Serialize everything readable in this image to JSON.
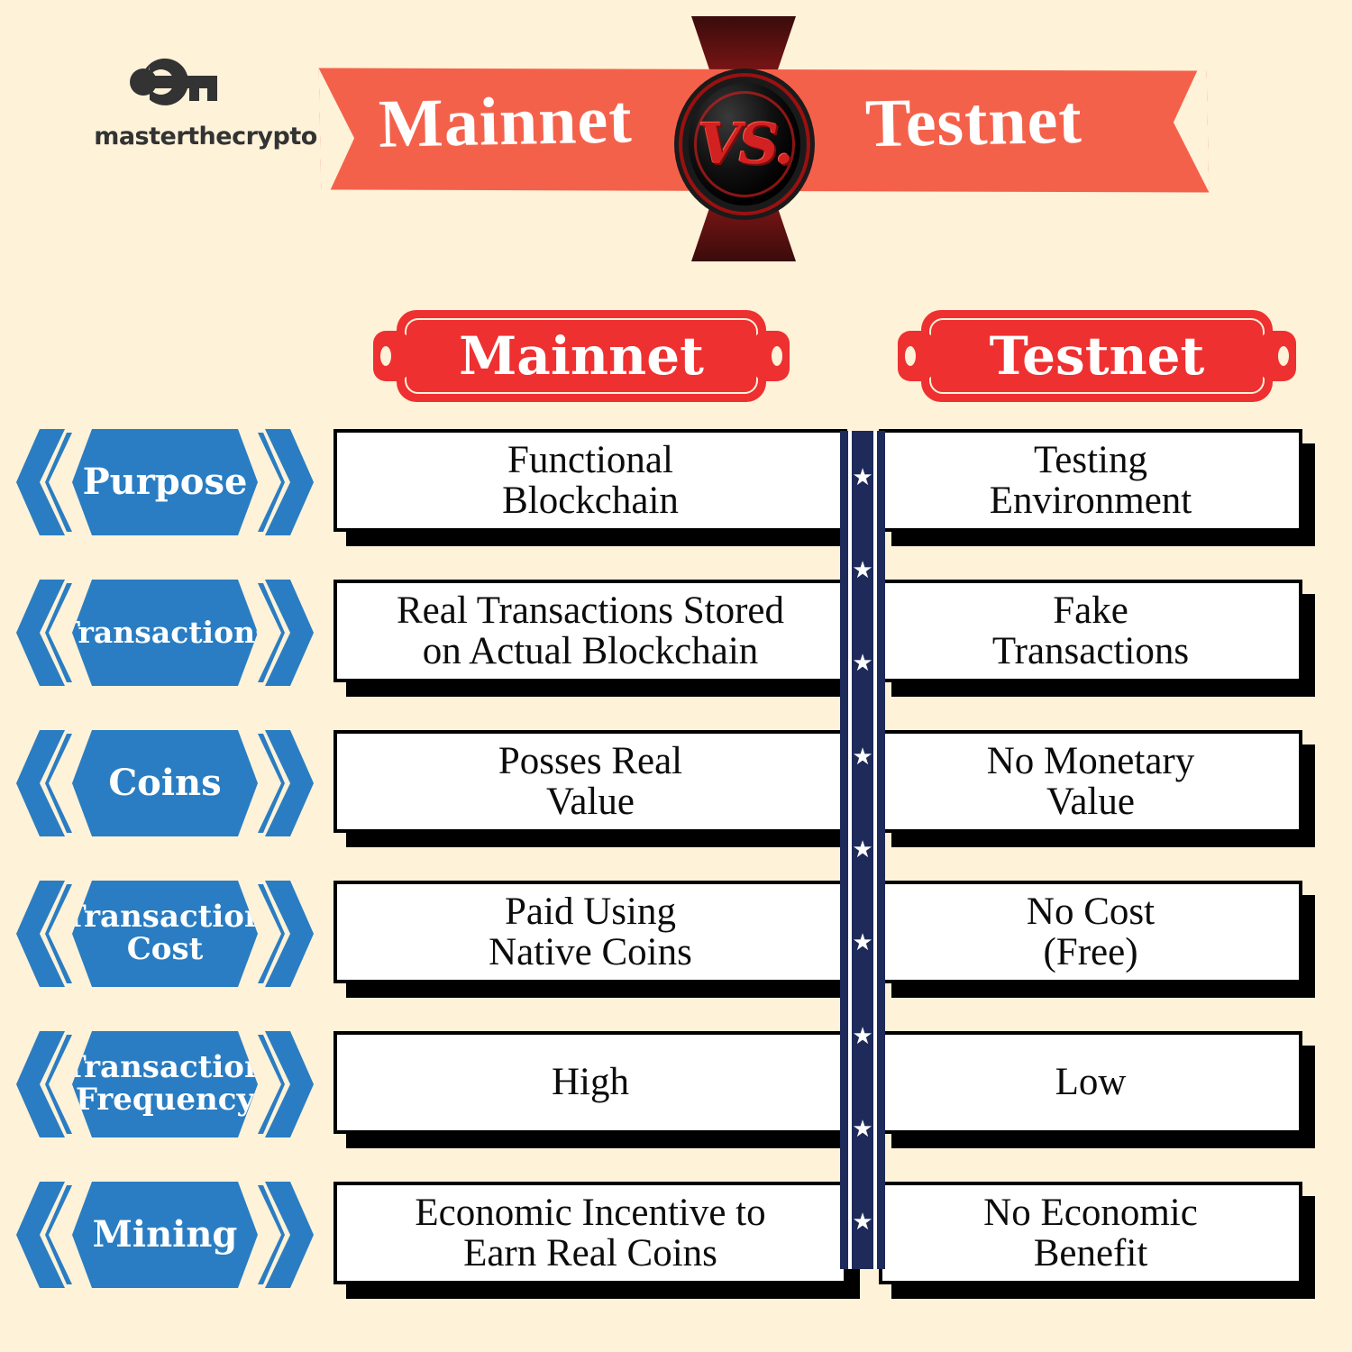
{
  "brand": {
    "name": "masterthecrypto",
    "logo_icon": "key-icon"
  },
  "banner": {
    "left_word": "Mainnet",
    "vs_label": "VS.",
    "right_word": "Testnet",
    "ribbon_color": "#F4614B",
    "badge_color": "#d22121"
  },
  "columns": {
    "left": "Mainnet",
    "right": "Testnet",
    "plaque_color": "#EE3031"
  },
  "divider": {
    "star_glyph": "★",
    "star_count": 9,
    "color": "#1E2A5A"
  },
  "accent": {
    "label_blue": "#2A7DC2",
    "background": "#FEF2D9"
  },
  "rows": [
    {
      "label": "Purpose",
      "label_lines": [
        "Purpose"
      ],
      "mainnet": [
        "Functional",
        "Blockchain"
      ],
      "testnet": [
        "Testing",
        "Environment"
      ]
    },
    {
      "label": "Transactions",
      "label_lines": [
        "Transactions"
      ],
      "mainnet": [
        "Real Transactions Stored",
        "on Actual Blockchain"
      ],
      "testnet": [
        "Fake",
        "Transactions"
      ]
    },
    {
      "label": "Coins",
      "label_lines": [
        "Coins"
      ],
      "mainnet": [
        "Posses Real",
        "Value"
      ],
      "testnet": [
        "No Monetary",
        "Value"
      ]
    },
    {
      "label": "Transaction Cost",
      "label_lines": [
        "Transaction",
        "Cost"
      ],
      "mainnet": [
        "Paid Using",
        "Native Coins"
      ],
      "testnet": [
        "No Cost",
        "(Free)"
      ]
    },
    {
      "label": "Transaction Frequency",
      "label_lines": [
        "Transaction",
        "Frequency"
      ],
      "mainnet": [
        "High"
      ],
      "testnet": [
        "Low"
      ]
    },
    {
      "label": "Mining",
      "label_lines": [
        "Mining"
      ],
      "mainnet": [
        "Economic Incentive to",
        "Earn Real Coins"
      ],
      "testnet": [
        "No Economic",
        "Benefit"
      ]
    }
  ]
}
